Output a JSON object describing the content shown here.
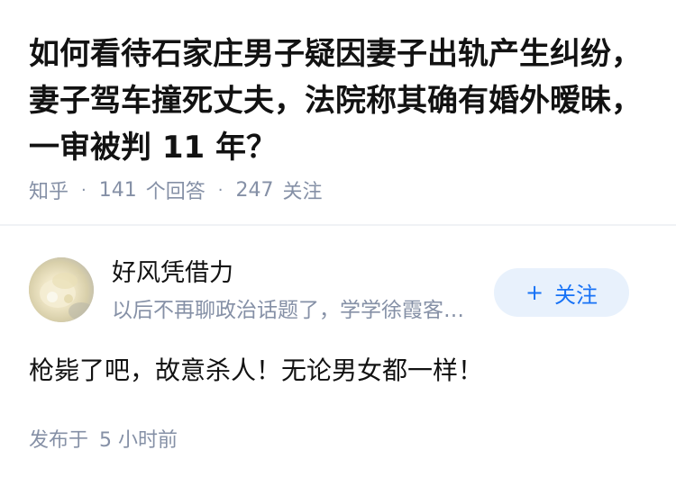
{
  "question": {
    "title": "如何看待石家庄男子疑因妻子出轨产生纠纷，妻子驾车撞死丈夫，法院称其确有婚外暧昧，一审被判 11 年？",
    "source": "知乎",
    "answer_count": "141",
    "answer_label": "个回答",
    "follower_count": "247",
    "follower_label": "关注",
    "separator": "·"
  },
  "author": {
    "name": "好风凭借力",
    "bio": "以后不再聊政治话题了，学学徐霞客去，寄情于山水之间",
    "avatar_icon": "avatar-image",
    "follow_label": "关注",
    "follow_icon_glyph": "+"
  },
  "answer": {
    "content": "枪毙了吧，故意杀人！无论男女都一样！",
    "published_prefix": "发布于",
    "published_time": "5 小时前"
  },
  "colors": {
    "title_text": "#121212",
    "meta_text": "#8590a6",
    "accent": "#1772f6",
    "follow_bg": "#e8f1fc",
    "divider": "#f0f2f5"
  }
}
